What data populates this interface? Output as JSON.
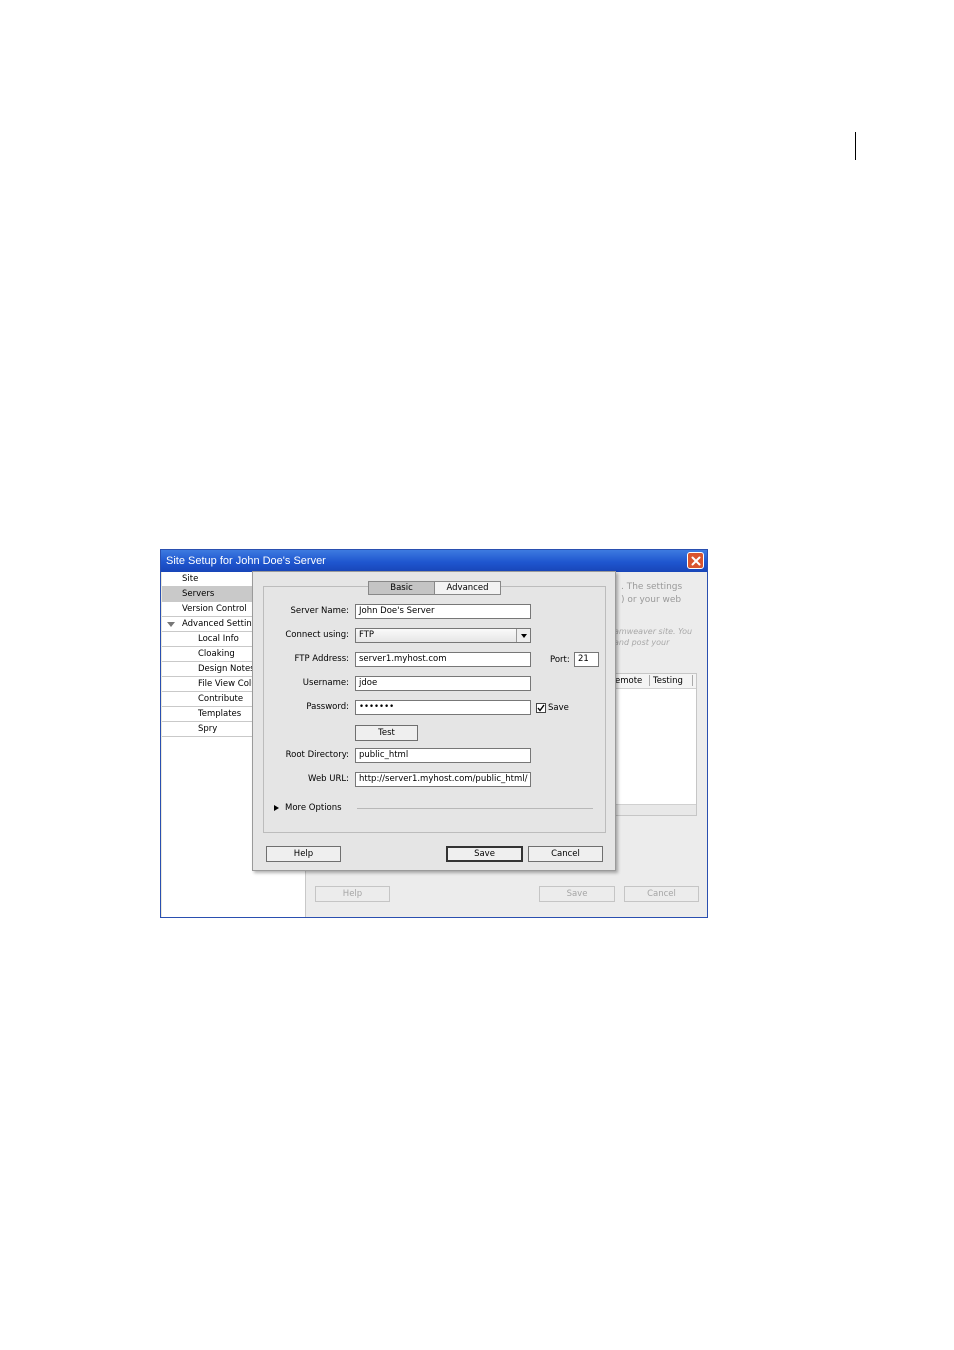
{
  "window": {
    "title": "Site Setup for John Doe's Server"
  },
  "sidebar": {
    "items": [
      {
        "label": "Site"
      },
      {
        "label": "Servers"
      },
      {
        "label": "Version Control"
      },
      {
        "label": "Advanced Settings"
      },
      {
        "label": "Local Info"
      },
      {
        "label": "Cloaking"
      },
      {
        "label": "Design Notes"
      },
      {
        "label": "File View Columns"
      },
      {
        "label": "Contribute"
      },
      {
        "label": "Templates"
      },
      {
        "label": "Spry"
      }
    ],
    "selected": "Servers"
  },
  "background_panel": {
    "text_line1": ". The settings",
    "text_line2": ") or your web",
    "italic_line1": "amweaver site. You",
    "italic_line2": "and post your",
    "col_remote": "emote",
    "col_testing": "Testing",
    "help_label": "Help",
    "save_label": "Save",
    "cancel_label": "Cancel"
  },
  "server_dialog": {
    "tabs": [
      {
        "label": "Basic",
        "active": true
      },
      {
        "label": "Advanced",
        "active": false
      }
    ],
    "server_name": {
      "label": "Server Name:",
      "value": "John Doe's Server"
    },
    "connect_using": {
      "label": "Connect using:",
      "value": "FTP"
    },
    "ftp_address": {
      "label": "FTP Address:",
      "value": "server1.myhost.com"
    },
    "port": {
      "label": "Port:",
      "value": "21"
    },
    "username": {
      "label": "Username:",
      "value": "jdoe"
    },
    "password": {
      "label": "Password:",
      "value": "•••••••"
    },
    "save_password": {
      "label": "Save",
      "checked": true
    },
    "test_button": "Test",
    "root_directory": {
      "label": "Root Directory:",
      "value": "public_html"
    },
    "web_url": {
      "label": "Web URL:",
      "value": "http://server1.myhost.com/public_html/"
    },
    "more_options": "More Options",
    "help_button": "Help",
    "save_button": "Save",
    "cancel_button": "Cancel"
  },
  "colors": {
    "titlebar": "#1f56cf",
    "close_button": "#d9542f",
    "selected_item": "#c9c9c9",
    "dialog_bg": "#e5e5e5"
  }
}
